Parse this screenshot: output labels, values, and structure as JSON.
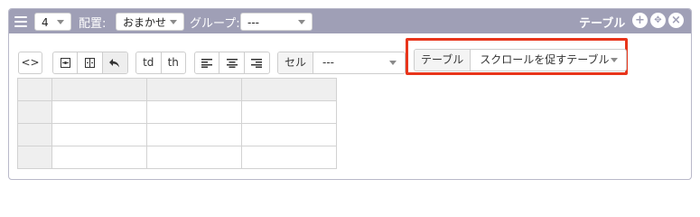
{
  "header": {
    "menu_icon": "hamburger-icon",
    "level_value": "4",
    "placement_label": "配置:",
    "placement_value": "おまかせ",
    "group_label": "グループ:",
    "group_value": "---",
    "table_label": "テーブル",
    "icons": [
      "plus-circle-icon",
      "move-circle-icon",
      "close-circle-icon"
    ],
    "color": "#9f9fb6"
  },
  "toolbar": {
    "source_label": "<>",
    "merge_icons": [
      "merge-cells-icon",
      "split-cells-icon",
      "undo-icon"
    ],
    "td_label": "td",
    "th_label": "th",
    "align_icons": [
      "align-left-icon",
      "align-center-icon",
      "align-right-icon"
    ],
    "cell_label": "セル",
    "cell_value": "---",
    "table_select_label": "テーブル",
    "table_select_value": "スクロールを促すテーブル"
  },
  "highlight_color": "#e8351b",
  "grid": {
    "rows": 4,
    "cols": 3
  }
}
